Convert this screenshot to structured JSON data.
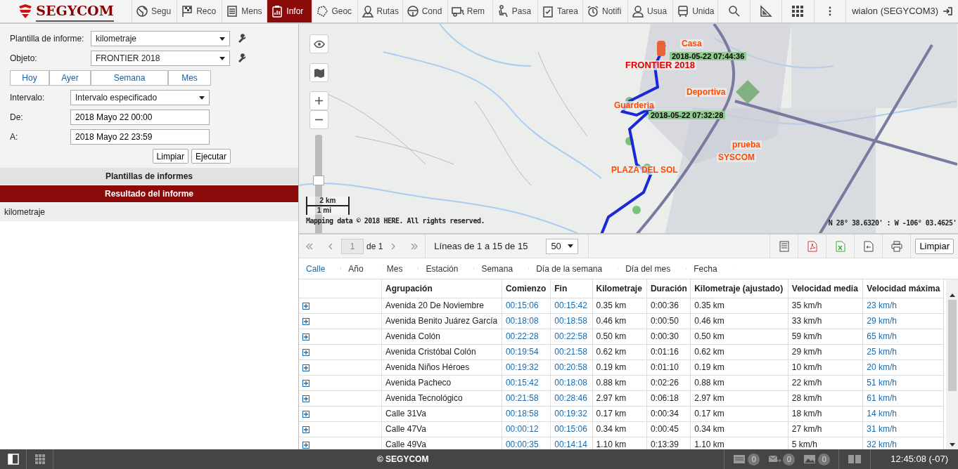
{
  "header": {
    "logo": "SEGYCOM",
    "tabs": [
      {
        "label": "Segu",
        "selected": false
      },
      {
        "label": "Reco",
        "selected": false
      },
      {
        "label": "Mens",
        "selected": false
      },
      {
        "label": "Infor",
        "selected": true
      },
      {
        "label": "Geoc",
        "selected": false
      },
      {
        "label": "Rutas",
        "selected": false
      },
      {
        "label": "Cond",
        "selected": false
      },
      {
        "label": "Rem",
        "selected": false
      },
      {
        "label": "Pasa",
        "selected": false
      },
      {
        "label": "Tarea",
        "selected": false
      },
      {
        "label": "Notifi",
        "selected": false
      },
      {
        "label": "Usua",
        "selected": false
      },
      {
        "label": "Unida",
        "selected": false
      }
    ],
    "user": "wialon (SEGYCOM3)"
  },
  "report_form": {
    "template": {
      "label": "Plantilla de informe:",
      "value": "kilometraje"
    },
    "object": {
      "label": "Objeto:",
      "value": "FRONTIER 2018"
    },
    "periods": [
      {
        "label": "Hoy",
        "selected": false
      },
      {
        "label": "Ayer",
        "selected": false
      },
      {
        "label": "Semana",
        "selected": false
      },
      {
        "label": "Mes",
        "selected": false
      }
    ],
    "interval": {
      "label": "Intervalo:",
      "value": "Intervalo especificado"
    },
    "from": {
      "label": "De:",
      "value": "2018 Mayo 22 00:00"
    },
    "to": {
      "label": "A:",
      "value": "2018 Mayo 22 23:59"
    },
    "actions": [
      "Limpiar",
      "Ejecutar"
    ]
  },
  "sections": [
    {
      "label": "Plantillas de informes",
      "selected": false
    },
    {
      "label": "Resultado del informe",
      "selected": true
    }
  ],
  "results": [
    "kilometraje"
  ],
  "map": {
    "labels": [
      {
        "kind": "geofence",
        "text": "Casa"
      },
      {
        "kind": "unit",
        "text": "FRONTIER 2018"
      },
      {
        "kind": "time",
        "text": "2018-05-22 07:44:36"
      },
      {
        "kind": "geofence",
        "text": "Deportiva"
      },
      {
        "kind": "geofence",
        "text": "Guarderia"
      },
      {
        "kind": "time",
        "text": "2018-05-22 07:32:28"
      },
      {
        "kind": "geofence",
        "text": "prueba"
      },
      {
        "kind": "geofence",
        "text": "SYSCOM"
      },
      {
        "kind": "geofence",
        "text": "PLAZA DEL SOL"
      }
    ],
    "zoom_slider": {
      "level": 0.55
    },
    "scale_km": "2 km",
    "scale_mi": "1 mi",
    "copyright": "Mapping data © 2018 HERE. All rights reserved.",
    "coordinates": "N 28° 38.6320' : W -106° 03.4625'"
  },
  "pager": {
    "page": "1",
    "of": "de 1",
    "lines": "Líneas de 1 a 15 de 15",
    "per_page": "50",
    "clear": "Limpiar"
  },
  "grouping": [
    {
      "label": "Calle",
      "selected": true
    },
    {
      "label": "Año",
      "selected": false
    },
    {
      "label": "Mes",
      "selected": false
    },
    {
      "label": "Estación",
      "selected": false
    },
    {
      "label": "Semana",
      "selected": false
    },
    {
      "label": "Día de la semana",
      "selected": false
    },
    {
      "label": "Día del mes",
      "selected": false
    },
    {
      "label": "Fecha",
      "selected": false
    }
  ],
  "table": {
    "columns": [
      {
        "label": "Agrupación",
        "link": false
      },
      {
        "label": "Comienzo",
        "link": true
      },
      {
        "label": "Fin",
        "link": true
      },
      {
        "label": "Kilometraje",
        "link": false
      },
      {
        "label": "Duración",
        "link": false
      },
      {
        "label": "Kilometraje (ajustado)",
        "link": false
      },
      {
        "label": "Velocidad media",
        "link": false
      },
      {
        "label": "Velocidad máxima",
        "link": true
      }
    ],
    "rows": [
      [
        "Avenida 20 De Noviembre",
        "00:15:06",
        "00:15:42",
        "0.35 km",
        "0:00:36",
        "0.35 km",
        "35 km/h",
        "23 km/h"
      ],
      [
        "Avenida Benito Juárez García",
        "00:18:08",
        "00:18:58",
        "0.46 km",
        "0:00:50",
        "0.46 km",
        "33 km/h",
        "29 km/h"
      ],
      [
        "Avenida Colón",
        "00:22:28",
        "00:22:58",
        "0.50 km",
        "0:00:30",
        "0.50 km",
        "59 km/h",
        "65 km/h"
      ],
      [
        "Avenida Cristóbal Colón",
        "00:19:54",
        "00:21:58",
        "0.62 km",
        "0:01:16",
        "0.62 km",
        "29 km/h",
        "25 km/h"
      ],
      [
        "Avenida Niños Héroes",
        "00:19:32",
        "00:20:58",
        "0.19 km",
        "0:01:10",
        "0.19 km",
        "10 km/h",
        "20 km/h"
      ],
      [
        "Avenida Pacheco",
        "00:15:42",
        "00:18:08",
        "0.88 km",
        "0:02:26",
        "0.88 km",
        "22 km/h",
        "51 km/h"
      ],
      [
        "Avenida Tecnológico",
        "00:21:58",
        "00:28:46",
        "2.97 km",
        "0:06:18",
        "2.97 km",
        "28 km/h",
        "61 km/h"
      ],
      [
        "Calle 31Va",
        "00:18:58",
        "00:19:32",
        "0.17 km",
        "0:00:34",
        "0.17 km",
        "18 km/h",
        "14 km/h"
      ],
      [
        "Calle 47Va",
        "00:00:12",
        "00:15:06",
        "0.34 km",
        "0:00:45",
        "0.34 km",
        "27 km/h",
        "31 km/h"
      ],
      [
        "Calle 49Va",
        "00:00:35",
        "00:14:14",
        "1.10 km",
        "0:13:39",
        "1.10 km",
        "5 km/h",
        "32 km/h"
      ]
    ]
  },
  "footer": {
    "copyright": "© SEGYCOM",
    "counters": [
      "0",
      "0",
      "0"
    ],
    "time": "12:45:08 (-07)"
  }
}
